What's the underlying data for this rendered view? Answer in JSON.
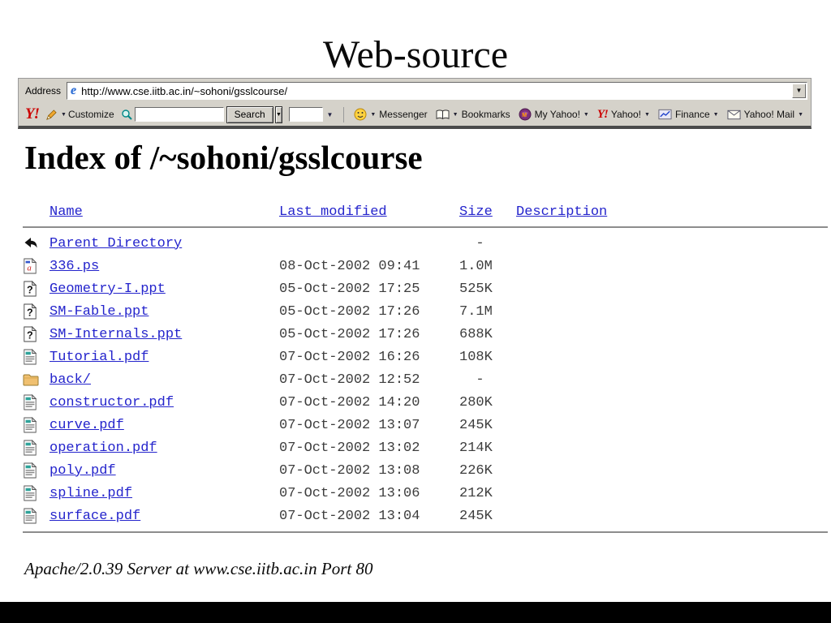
{
  "slide": {
    "title": "Web-source"
  },
  "browser": {
    "address_label": "Address",
    "address_url": "http://www.cse.iitb.ac.in/~sohoni/gsslcourse/",
    "toolbar": {
      "logo_text": "Y!",
      "customize_label": "Customize",
      "search_button_label": "Search",
      "items": [
        {
          "icon": "smiley-icon",
          "label": "Messenger",
          "arrow_after_icon": true
        },
        {
          "icon": "bookmarks-icon",
          "label": "Bookmarks",
          "arrow_after_icon": true
        },
        {
          "icon": "my-yahoo-icon",
          "label": "My Yahoo!",
          "arrow_after_icon": false
        },
        {
          "icon": "yahoo-icon",
          "label": "Yahoo!",
          "arrow_after_icon": false
        },
        {
          "icon": "finance-icon",
          "label": "Finance",
          "arrow_after_icon": false
        },
        {
          "icon": "mail-icon",
          "label": "Yahoo! Mail",
          "arrow_after_icon": false
        }
      ]
    }
  },
  "page": {
    "heading": "Index of /~sohoni/gsslcourse",
    "columns": [
      "Name",
      "Last modified",
      "Size",
      "Description"
    ],
    "rows": [
      {
        "icon": "back-icon",
        "name": "Parent Directory",
        "modified": "",
        "size": "  -"
      },
      {
        "icon": "postscript-icon",
        "name": "336.ps",
        "modified": "08-Oct-2002 09:41",
        "size": "1.0M"
      },
      {
        "icon": "unknown-file-icon",
        "name": "Geometry-I.ppt",
        "modified": "05-Oct-2002 17:25",
        "size": "525K"
      },
      {
        "icon": "unknown-file-icon",
        "name": "SM-Fable.ppt",
        "modified": "05-Oct-2002 17:26",
        "size": "7.1M"
      },
      {
        "icon": "unknown-file-icon",
        "name": "SM-Internals.ppt",
        "modified": "05-Oct-2002 17:26",
        "size": "688K"
      },
      {
        "icon": "text-file-icon",
        "name": "Tutorial.pdf",
        "modified": "07-Oct-2002 16:26",
        "size": "108K"
      },
      {
        "icon": "folder-icon",
        "name": "back/",
        "modified": "07-Oct-2002 12:52",
        "size": "  -"
      },
      {
        "icon": "text-file-icon",
        "name": "constructor.pdf",
        "modified": "07-Oct-2002 14:20",
        "size": "280K"
      },
      {
        "icon": "text-file-icon",
        "name": "curve.pdf",
        "modified": "07-Oct-2002 13:07",
        "size": "245K"
      },
      {
        "icon": "text-file-icon",
        "name": "operation.pdf",
        "modified": "07-Oct-2002 13:02",
        "size": "214K"
      },
      {
        "icon": "text-file-icon",
        "name": "poly.pdf",
        "modified": "07-Oct-2002 13:08",
        "size": "226K"
      },
      {
        "icon": "text-file-icon",
        "name": "spline.pdf",
        "modified": "07-Oct-2002 13:06",
        "size": "212K"
      },
      {
        "icon": "text-file-icon",
        "name": "surface.pdf",
        "modified": "07-Oct-2002 13:04",
        "size": "245K"
      }
    ],
    "footer": "Apache/2.0.39 Server at www.cse.iitb.ac.in Port 80"
  },
  "colors": {
    "link": "#2424cc",
    "toolbar_bg": "#d5d2ca",
    "yahoo_red": "#cc0000",
    "listing_text": "#3d3d3d"
  }
}
